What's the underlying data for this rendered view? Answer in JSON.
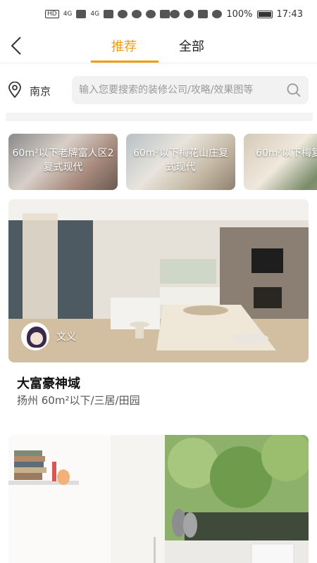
{
  "status_bar": {
    "hd": "HD",
    "sig1": "4G",
    "sig2": "4G",
    "battery": "100%",
    "time": "17:43"
  },
  "header": {
    "tabs": [
      {
        "label": "推荐",
        "active": true
      },
      {
        "label": "全部",
        "active": false
      }
    ],
    "accent": "#f39c12"
  },
  "search": {
    "location": "南京",
    "placeholder": "输入您要搜索的装修公司/攻略/效果图等"
  },
  "thumbnails": [
    {
      "label": "60m²以下老牌富人区2复式现代"
    },
    {
      "label": "60m²以下梅花山庄复式现代"
    },
    {
      "label": "60m²以下梅复式现"
    }
  ],
  "cards": [
    {
      "author": "文义",
      "title": "大富豪神域",
      "meta": "扬州   60m²以下/三居/田园"
    }
  ]
}
